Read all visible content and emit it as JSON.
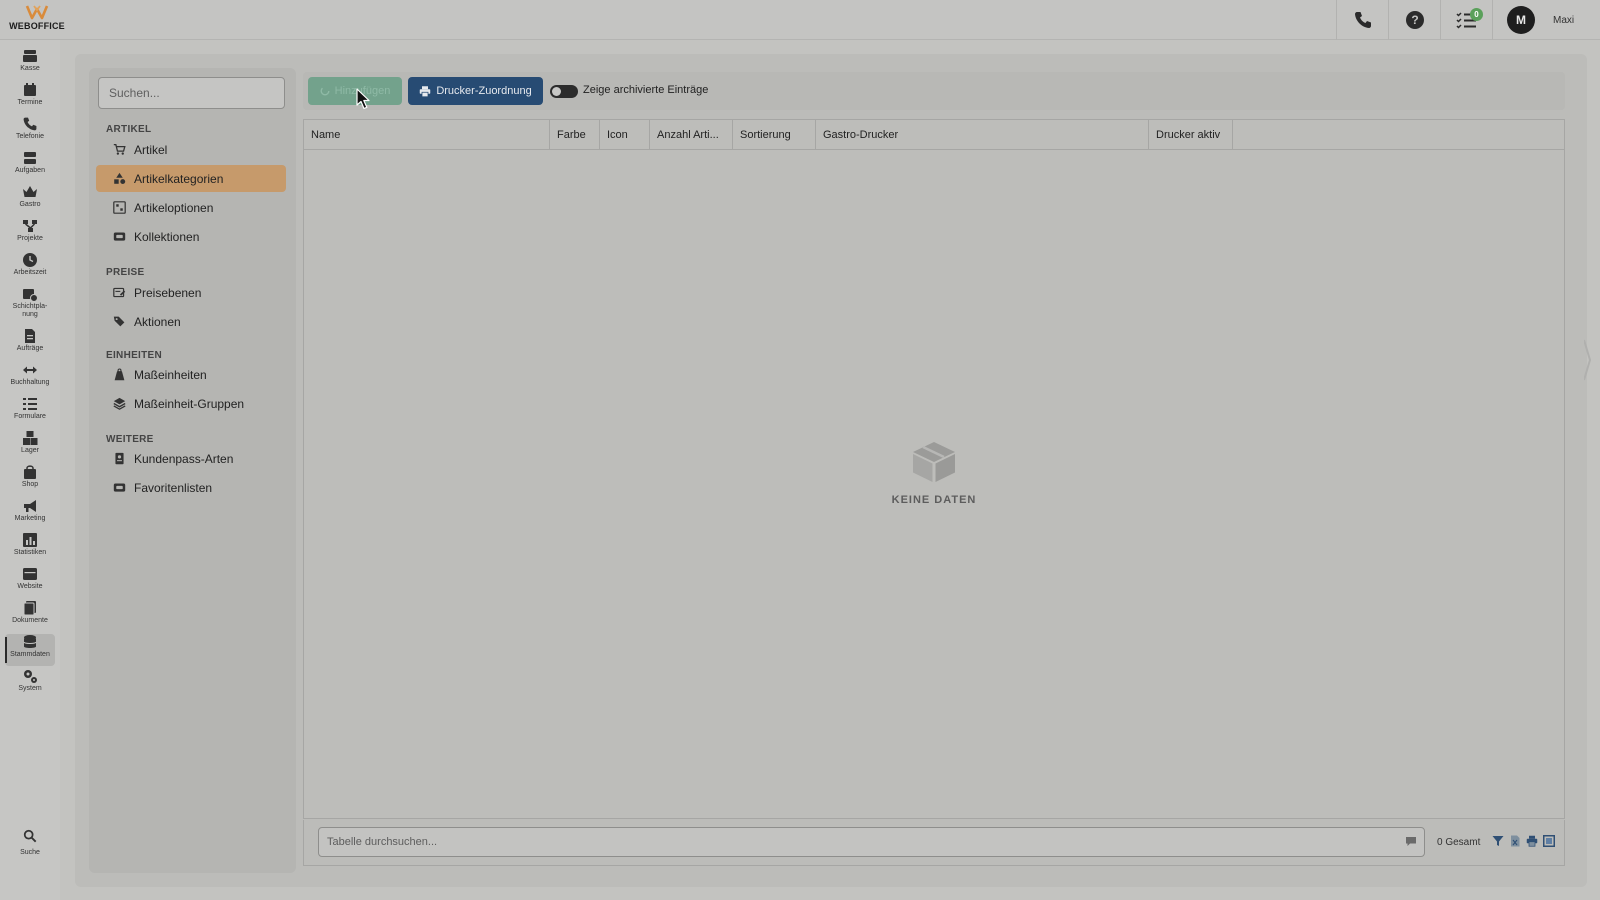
{
  "app": {
    "logo_text": "WEBOFFICE",
    "user_initial": "M",
    "user_name": "Maxi",
    "notification_count": "0"
  },
  "rail": {
    "items": [
      {
        "label": "Kasse",
        "icon": "cash-register-icon"
      },
      {
        "label": "Termine",
        "icon": "calendar-icon"
      },
      {
        "label": "Telefonie",
        "icon": "phone-icon"
      },
      {
        "label": "Aufgaben",
        "icon": "tasks-icon"
      },
      {
        "label": "Gastro",
        "icon": "crown-icon"
      },
      {
        "label": "Projekte",
        "icon": "project-icon"
      },
      {
        "label": "Arbeitszeit",
        "icon": "clock-icon"
      },
      {
        "label": "Schichtpla-",
        "label2": "nung",
        "icon": "shift-plan-icon"
      },
      {
        "label": "Aufträge",
        "icon": "order-icon"
      },
      {
        "label": "Buchhaltung",
        "icon": "arrows-icon"
      },
      {
        "label": "Formulare",
        "icon": "form-icon"
      },
      {
        "label": "Lager",
        "icon": "boxes-icon"
      },
      {
        "label": "Shop",
        "icon": "shopping-bag-icon"
      },
      {
        "label": "Marketing",
        "icon": "megaphone-icon"
      },
      {
        "label": "Statistiken",
        "icon": "chart-icon"
      },
      {
        "label": "Website",
        "icon": "window-icon"
      },
      {
        "label": "Dokumente",
        "icon": "documents-icon"
      },
      {
        "label": "Stammdaten",
        "icon": "database-icon"
      },
      {
        "label": "System",
        "icon": "cogs-icon"
      }
    ],
    "search_label": "Suche"
  },
  "nav": {
    "search_placeholder": "Suchen...",
    "sections": {
      "artikel": "ARTIKEL",
      "preise": "PREISE",
      "einheiten": "EINHEITEN",
      "weitere": "WEITERE"
    },
    "items": {
      "artikel": "Artikel",
      "artikelkategorien": "Artikelkategorien",
      "artikeloptionen": "Artikeloptionen",
      "kollektionen": "Kollektionen",
      "preisebenen": "Preisebenen",
      "aktionen": "Aktionen",
      "masseinheiten": "Maßeinheiten",
      "masseinheit_gruppen": "Maßeinheit-Gruppen",
      "kundenpass_arten": "Kundenpass-Arten",
      "favoritenlisten": "Favoritenlisten"
    },
    "active": "artikelkategorien"
  },
  "toolbar": {
    "add_label": "Hinzufügen",
    "printer_label": "Drucker-Zuordnung",
    "archive_toggle_label": "Zeige archivierte Einträge",
    "archive_toggle_on": false
  },
  "table": {
    "columns": [
      {
        "label": "Name"
      },
      {
        "label": "Farbe"
      },
      {
        "label": "Icon"
      },
      {
        "label": "Anzahl Arti..."
      },
      {
        "label": "Sortierung"
      },
      {
        "label": "Gastro-Drucker"
      },
      {
        "label": "Drucker aktiv"
      }
    ],
    "rows": [],
    "empty_text": "KEINE DATEN"
  },
  "footer": {
    "search_placeholder": "Tabelle durchsuchen...",
    "total_text": "0 Gesamt"
  },
  "colors": {
    "active_nav": "#c69a6b",
    "printer_button": "#274b73",
    "add_button": "#73a28c",
    "badge": "#5aa05a",
    "logo_accent": "#d98b3b"
  }
}
